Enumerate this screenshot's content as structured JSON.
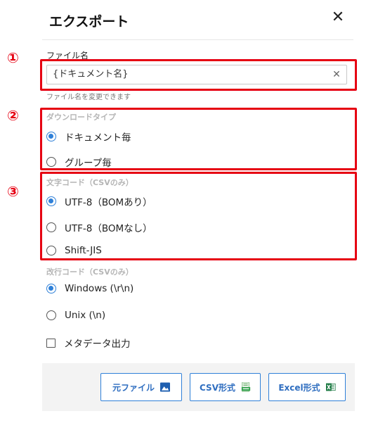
{
  "dialog": {
    "title": "エクスポート",
    "close_glyph": "✕"
  },
  "annotations": {
    "m1": "①",
    "m2": "②",
    "m3": "③"
  },
  "filename": {
    "label": "ファイル名",
    "value": "{ドキュメント名}",
    "clear_glyph": "✕",
    "help": "ファイル名を変更できます"
  },
  "download_type": {
    "label": "ダウンロードタイプ",
    "options": [
      {
        "label": "ドキュメント毎",
        "selected": true
      },
      {
        "label": "グループ毎",
        "selected": false
      }
    ]
  },
  "encoding": {
    "label": "文字コード（CSVのみ）",
    "options": [
      {
        "label": "UTF-8（BOMあり）",
        "selected": true
      },
      {
        "label": "UTF-8（BOMなし）",
        "selected": false
      },
      {
        "label": "Shift-JIS",
        "selected": false
      }
    ]
  },
  "newline": {
    "label": "改行コード（CSVのみ）",
    "options": [
      {
        "label": "Windows (\\r\\n)",
        "selected": true
      },
      {
        "label": "Unix (\\n)",
        "selected": false
      }
    ]
  },
  "metadata": {
    "label": "メタデータ出力",
    "checked": false
  },
  "buttons": {
    "original": "元ファイル",
    "csv": "CSV形式",
    "excel": "Excel形式"
  },
  "colors": {
    "accent": "#2f80d8",
    "annotation_red": "#e60012"
  }
}
